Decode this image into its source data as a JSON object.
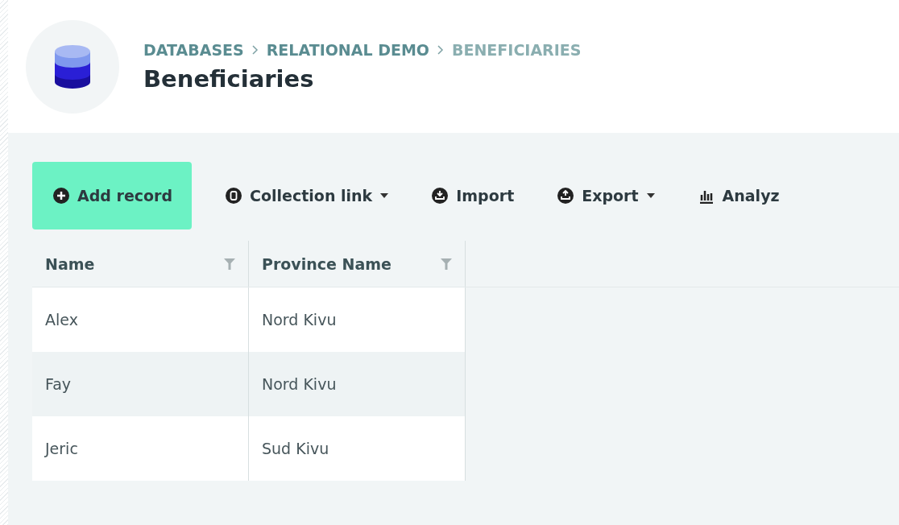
{
  "breadcrumbs": [
    {
      "label": "DATABASES",
      "selected": false
    },
    {
      "label": "RELATIONAL DEMO",
      "selected": false
    },
    {
      "label": "BENEFICIARIES",
      "selected": true
    }
  ],
  "title": "Beneficiaries",
  "toolbar": [
    {
      "label": "Add record",
      "kind": "primary",
      "has_menu": false
    },
    {
      "label": "Collection link",
      "kind": "plain",
      "has_menu": true
    },
    {
      "label": "Import",
      "kind": "plain",
      "has_menu": false
    },
    {
      "label": "Export",
      "kind": "plain",
      "has_menu": true
    },
    {
      "label": "Analyz",
      "kind": "plain",
      "has_menu": false
    }
  ],
  "table": {
    "columns": [
      "Name",
      "Province Name"
    ],
    "rows": [
      [
        "Alex",
        "Nord Kivu"
      ],
      [
        "Fay",
        "Nord Kivu"
      ],
      [
        "Jeric",
        "Sud Kivu"
      ]
    ]
  }
}
